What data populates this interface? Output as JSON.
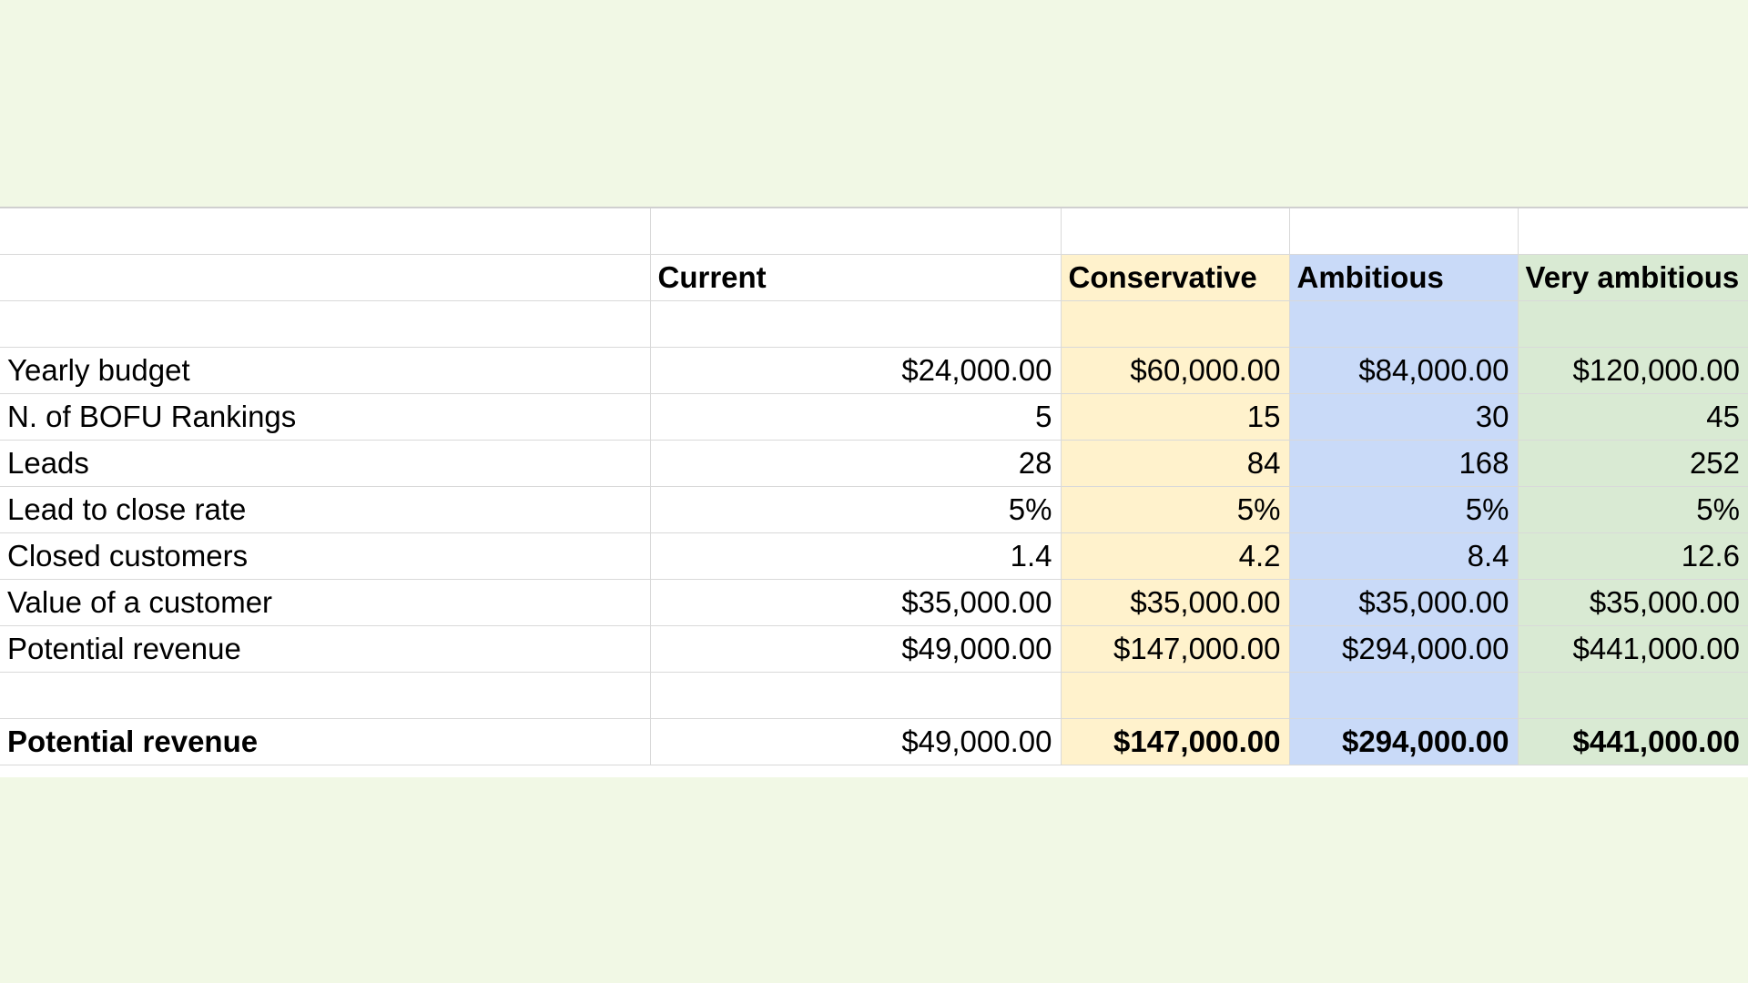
{
  "colors": {
    "page_background": "#f1f8e5",
    "conservative_fill": "#fff2cc",
    "ambitious_fill": "#c9daf8",
    "very_ambitious_fill": "#d9ead3",
    "gridline": "#d9d9d9"
  },
  "table": {
    "headers": [
      "",
      "Current",
      "Conservative",
      "Ambitious",
      "Very ambitious"
    ],
    "rows": [
      {
        "label": "Yearly budget",
        "values": [
          "$24,000.00",
          "$60,000.00",
          "$84,000.00",
          "$120,000.00"
        ]
      },
      {
        "label": "N. of BOFU Rankings",
        "values": [
          "5",
          "15",
          "30",
          "45"
        ]
      },
      {
        "label": "Leads",
        "values": [
          "28",
          "84",
          "168",
          "252"
        ]
      },
      {
        "label": "Lead to close rate",
        "values": [
          "5%",
          "5%",
          "5%",
          "5%"
        ]
      },
      {
        "label": "Closed customers",
        "values": [
          "1.4",
          "4.2",
          "8.4",
          "12.6"
        ]
      },
      {
        "label": "Value of a customer",
        "values": [
          "$35,000.00",
          "$35,000.00",
          "$35,000.00",
          "$35,000.00"
        ]
      },
      {
        "label": "Potential revenue",
        "values": [
          "$49,000.00",
          "$147,000.00",
          "$294,000.00",
          "$441,000.00"
        ]
      }
    ],
    "total": {
      "label": "Potential revenue",
      "values": [
        "$49,000.00",
        "$147,000.00",
        "$294,000.00",
        "$441,000.00"
      ]
    }
  }
}
